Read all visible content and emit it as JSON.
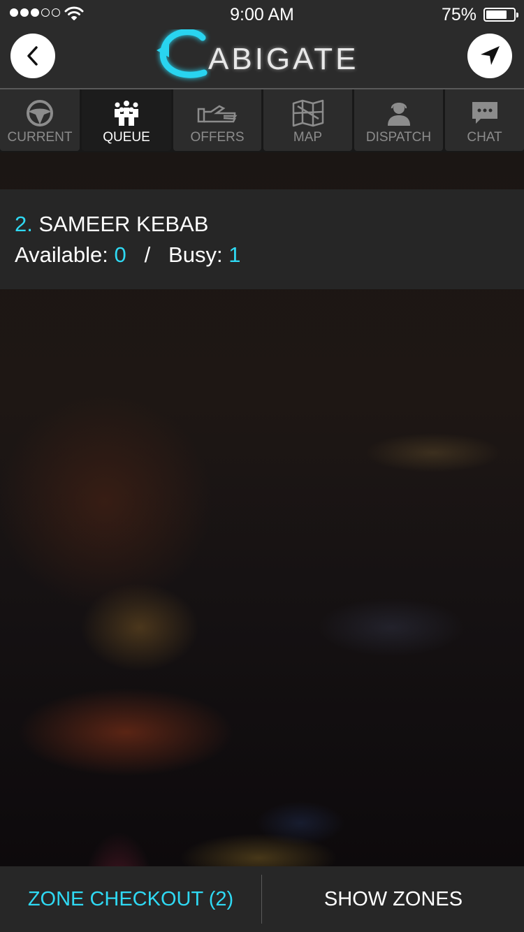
{
  "status_bar": {
    "time": "9:00 AM",
    "battery_percent": "75%",
    "battery_level": 0.75,
    "signal_bars_filled": 3,
    "signal_bars_total": 5
  },
  "header": {
    "logo_text": "ABIGATE",
    "back_icon": "chevron-left-icon",
    "location_icon": "navigation-arrow-icon"
  },
  "tabs": [
    {
      "label": "CURRENT",
      "icon": "steering-wheel-icon",
      "active": false
    },
    {
      "label": "QUEUE",
      "icon": "people-group-icon",
      "active": true
    },
    {
      "label": "OFFERS",
      "icon": "hand-offer-icon",
      "active": false
    },
    {
      "label": "MAP",
      "icon": "map-icon",
      "active": false
    },
    {
      "label": "DISPATCH",
      "icon": "operator-headset-icon",
      "active": false
    },
    {
      "label": "CHAT",
      "icon": "chat-bubble-icon",
      "active": false
    }
  ],
  "zone": {
    "number": "2.",
    "name": "SAMEER KEBAB",
    "available_label": "Available:",
    "available_value": "0",
    "separator": "/",
    "busy_label": "Busy:",
    "busy_value": "1"
  },
  "footer": {
    "zone_checkout_label": "ZONE CHECKOUT (2)",
    "show_zones_label": "SHOW ZONES"
  },
  "colors": {
    "accent": "#2fd9f3",
    "bar_bg": "#2b2b2b",
    "tab_bg": "#2c2c2c",
    "card_bg": "#262626"
  }
}
